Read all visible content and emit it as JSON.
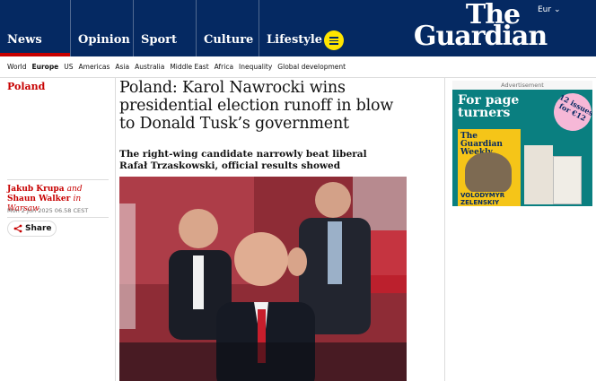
{
  "header": {
    "edition": "Eur",
    "logo_line1": "The",
    "logo_line2": "Guardian",
    "pillars": [
      {
        "label": "News",
        "color": "#c70000"
      },
      {
        "label": "Opinion",
        "color": "#e05e00"
      },
      {
        "label": "Sport",
        "color": "#0077b6"
      },
      {
        "label": "Culture",
        "color": "#a1845c"
      },
      {
        "label": "Lifestyle",
        "color": "#bb3b80"
      }
    ],
    "menu_icon": "hamburger-menu-icon"
  },
  "subnav": [
    "World",
    "Europe",
    "US",
    "Americas",
    "Asia",
    "Australia",
    "Middle East",
    "Africa",
    "Inequality",
    "Global development"
  ],
  "subnav_active": "Europe",
  "article": {
    "section": "Poland",
    "headline": "Poland: Karol Nawrocki wins presidential election runoff in blow to Donald Tusk’s government",
    "standfirst": "The right-wing candidate narrowly beat liberal Rafał Trzaskowski, official results showed",
    "byline": {
      "author1": "Jakub Krupa",
      "and": "and",
      "author2": "Shaun Walker",
      "in": "in Warsaw"
    },
    "date": "Mon 2 Jun 2025 06.58 CEST",
    "share_label": "Share"
  },
  "ad": {
    "label": "Advertisement",
    "title": "For page turners",
    "badge": "12 issues for €12",
    "magazine_title": "The Guardian Weekly",
    "magazine_cover_name": "VOLODYMYR ZELENSKIY"
  }
}
